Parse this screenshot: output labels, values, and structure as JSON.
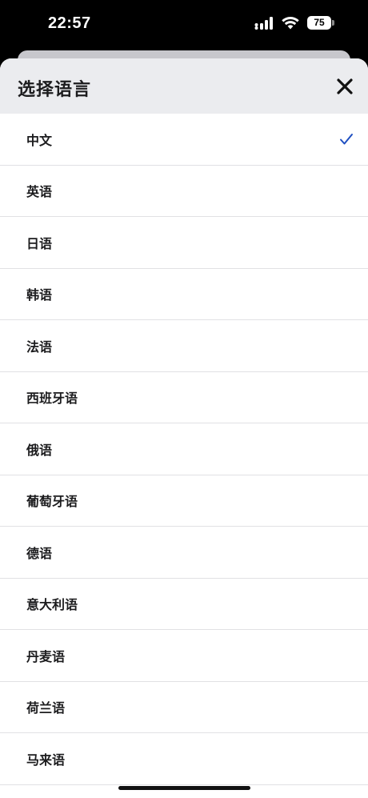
{
  "status_bar": {
    "time": "22:57",
    "battery_percent": "75",
    "icons": [
      "signal-icon",
      "wifi-icon",
      "battery-icon"
    ]
  },
  "sheet": {
    "title": "选择语言",
    "close_icon": "close-icon"
  },
  "languages": [
    {
      "label": "中文",
      "selected": true
    },
    {
      "label": "英语",
      "selected": false
    },
    {
      "label": "日语",
      "selected": false
    },
    {
      "label": "韩语",
      "selected": false
    },
    {
      "label": "法语",
      "selected": false
    },
    {
      "label": "西班牙语",
      "selected": false
    },
    {
      "label": "俄语",
      "selected": false
    },
    {
      "label": "葡萄牙语",
      "selected": false
    },
    {
      "label": "德语",
      "selected": false
    },
    {
      "label": "意大利语",
      "selected": false
    },
    {
      "label": "丹麦语",
      "selected": false
    },
    {
      "label": "荷兰语",
      "selected": false
    },
    {
      "label": "马来语",
      "selected": false
    }
  ],
  "colors": {
    "check_accent": "#1f4fc1",
    "header_bg": "#ebecef"
  }
}
